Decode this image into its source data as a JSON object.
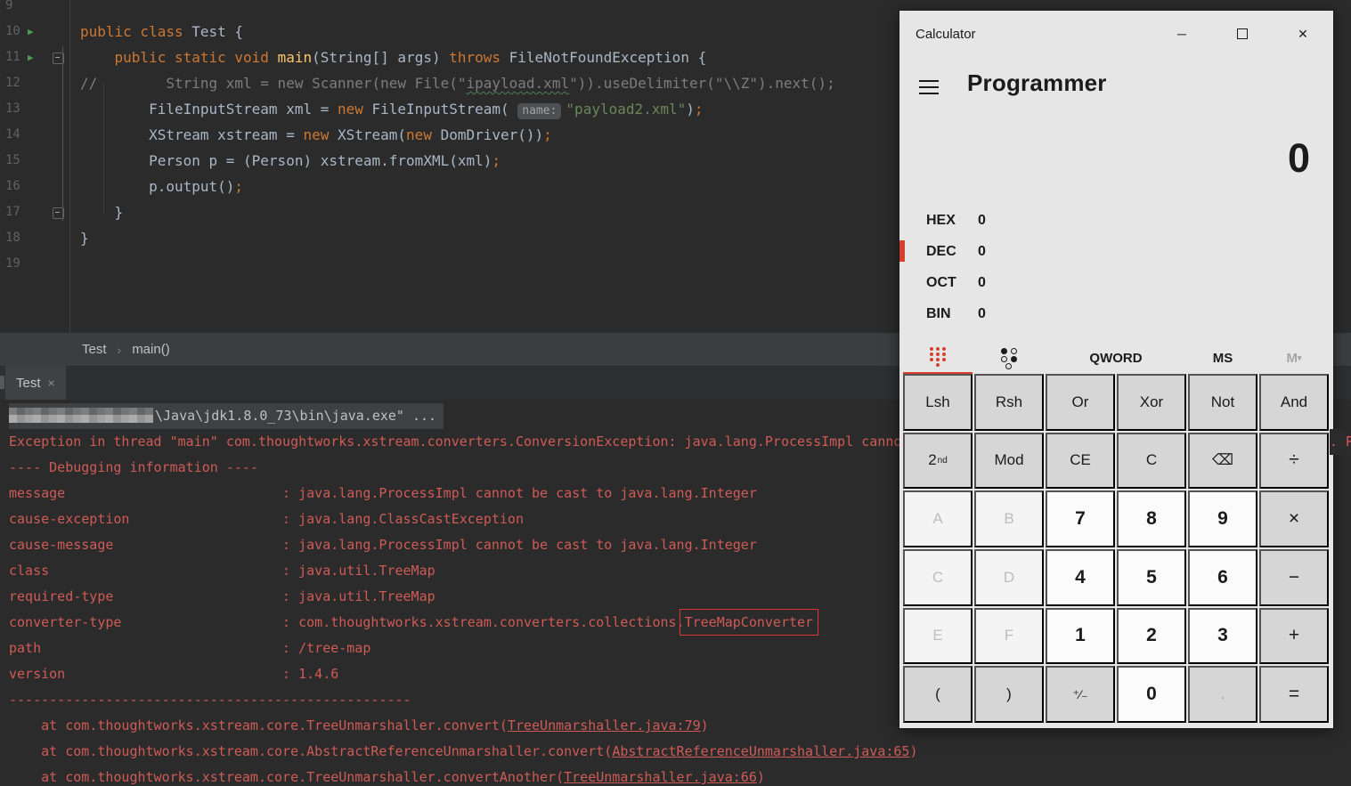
{
  "editor": {
    "lines": [
      {
        "num": "9",
        "seg": []
      },
      {
        "num": "10",
        "run": true,
        "seg": [
          [
            "kw",
            "public class "
          ],
          [
            "pl",
            "Test {"
          ]
        ]
      },
      {
        "num": "11",
        "run": true,
        "fold": true,
        "seg": [
          [
            "pl",
            "    "
          ],
          [
            "kw",
            "public static void "
          ],
          [
            "mth",
            "main"
          ],
          [
            "pl",
            "(String[] args) "
          ],
          [
            "kw",
            "throws "
          ],
          [
            "pl",
            "FileNotFoundException {"
          ]
        ]
      },
      {
        "num": "12",
        "seg": [
          [
            "cmt",
            "//        String xml = new Scanner(new File(\""
          ],
          [
            "sq",
            "ipayload.xml"
          ],
          [
            "cmt",
            "\")).useDelimiter(\"\\\\Z\").next();"
          ]
        ]
      },
      {
        "num": "13",
        "seg": [
          [
            "pl",
            "        FileInputStream xml = "
          ],
          [
            "kw",
            "new "
          ],
          [
            "pl",
            "FileInputStream( "
          ],
          [
            "hint",
            "name:"
          ],
          [
            "str",
            "\"payload2.xml\""
          ],
          [
            "pl",
            ")"
          ],
          [
            "kw",
            ";"
          ]
        ]
      },
      {
        "num": "14",
        "seg": [
          [
            "pl",
            "        XStream xstream = "
          ],
          [
            "kw",
            "new "
          ],
          [
            "pl",
            "XStream("
          ],
          [
            "kw",
            "new "
          ],
          [
            "pl",
            "DomDriver())"
          ],
          [
            "kw",
            ";"
          ]
        ]
      },
      {
        "num": "15",
        "seg": [
          [
            "pl",
            "        Person p = (Person) xstream.fromXML(xml)"
          ],
          [
            "kw",
            ";"
          ]
        ]
      },
      {
        "num": "16",
        "seg": [
          [
            "pl",
            "        p.output()"
          ],
          [
            "kw",
            ";"
          ]
        ]
      },
      {
        "num": "17",
        "fold": true,
        "seg": [
          [
            "pl",
            "    }"
          ]
        ]
      },
      {
        "num": "18",
        "seg": [
          [
            "pl",
            "}"
          ]
        ]
      },
      {
        "num": "19",
        "seg": []
      }
    ]
  },
  "breadcrumb": {
    "items": [
      "Test",
      "main()"
    ],
    "separator": "›"
  },
  "console_tab": {
    "label": "Test",
    "close_glyph": "×"
  },
  "console": {
    "cmd_line_text": "\\Java\\jdk1.8.0_73\\bin\\java.exe\" ...",
    "exception_line": "Exception in thread \"main\" com.thoughtworks.xstream.converters.ConversionException: java.lang.ProcessImpl cannot be cast to java.lang.Integer : java.lang.ProcessImpl cannot be cast to java.lang.Integer",
    "edge_fragment": ". Pr",
    "debug_header": "---- Debugging information ----",
    "entries": [
      {
        "key": "message",
        "segs": [
          [
            "v",
            "java.lang.ProcessImpl cannot be cast to java.lang.Integer"
          ]
        ]
      },
      {
        "key": "cause-exception",
        "segs": [
          [
            "v",
            "java.lang.ClassCastException"
          ]
        ]
      },
      {
        "key": "cause-message",
        "segs": [
          [
            "v",
            "java.lang.ProcessImpl cannot be cast to java.lang.Integer"
          ]
        ]
      },
      {
        "key": "class",
        "segs": [
          [
            "v",
            "java.util.TreeMap"
          ]
        ]
      },
      {
        "key": "required-type",
        "segs": [
          [
            "v",
            "java.util.TreeMap"
          ]
        ]
      },
      {
        "key": "converter-type",
        "segs": [
          [
            "v",
            "com.thoughtworks.xstream.converters.collections."
          ],
          [
            "box",
            "TreeMapConverter"
          ]
        ]
      },
      {
        "key": "path",
        "segs": [
          [
            "v",
            "/tree-map"
          ]
        ]
      },
      {
        "key": "version",
        "segs": [
          [
            "v",
            "1.4.6"
          ]
        ]
      }
    ],
    "divider": "--------------------------------------------------",
    "stack": [
      {
        "pre": "    at com.thoughtworks.xstream.core.TreeUnmarshaller.convert(",
        "link": "TreeUnmarshaller.java:79",
        "post": ")"
      },
      {
        "pre": "    at com.thoughtworks.xstream.core.AbstractReferenceUnmarshaller.convert(",
        "link": "AbstractReferenceUnmarshaller.java:65",
        "post": ")"
      },
      {
        "pre": "    at com.thoughtworks.xstream.core.TreeUnmarshaller.convertAnother(",
        "link": "TreeUnmarshaller.java:66",
        "post": ")"
      }
    ]
  },
  "calculator": {
    "title": "Calculator",
    "minimize_glyph": "─",
    "close_glyph": "✕",
    "mode": "Programmer",
    "display_value": "0",
    "radix_rows": [
      {
        "label": "HEX",
        "value": "0",
        "active": false
      },
      {
        "label": "DEC",
        "value": "0",
        "active": true
      },
      {
        "label": "OCT",
        "value": "0",
        "active": false
      },
      {
        "label": "BIN",
        "value": "0",
        "active": false
      }
    ],
    "toolbar": {
      "word_size": "QWORD",
      "memory_store": "MS",
      "memory_base": "M",
      "memory_sup": "▾"
    },
    "accent_red": "#d5402e",
    "key_rows": [
      [
        {
          "l": "Lsh",
          "n": "lsh",
          "t": "fn"
        },
        {
          "l": "Rsh",
          "n": "rsh",
          "t": "fn"
        },
        {
          "l": "Or",
          "n": "or",
          "t": "fn"
        },
        {
          "l": "Xor",
          "n": "xor",
          "t": "fn"
        },
        {
          "l": "Not",
          "n": "not",
          "t": "fn"
        },
        {
          "l": "And",
          "n": "and",
          "t": "fn"
        }
      ],
      [
        {
          "l": "2",
          "sup": "nd",
          "n": "second",
          "t": "fn"
        },
        {
          "l": "Mod",
          "n": "mod",
          "t": "fn"
        },
        {
          "l": "CE",
          "n": "clear-entry",
          "t": "fn"
        },
        {
          "l": "C",
          "n": "clear",
          "t": "fn"
        },
        {
          "l": "⌫",
          "n": "backspace",
          "t": "fn"
        },
        {
          "l": "÷",
          "n": "divide",
          "t": "op"
        }
      ],
      [
        {
          "l": "A",
          "n": "hex-a",
          "t": "hex"
        },
        {
          "l": "B",
          "n": "hex-b",
          "t": "hex"
        },
        {
          "l": "7",
          "n": "7",
          "t": "num"
        },
        {
          "l": "8",
          "n": "8",
          "t": "num"
        },
        {
          "l": "9",
          "n": "9",
          "t": "num"
        },
        {
          "l": "×",
          "n": "multiply",
          "t": "op"
        }
      ],
      [
        {
          "l": "C",
          "n": "hex-c",
          "t": "hex"
        },
        {
          "l": "D",
          "n": "hex-d",
          "t": "hex"
        },
        {
          "l": "4",
          "n": "4",
          "t": "num"
        },
        {
          "l": "5",
          "n": "5",
          "t": "num"
        },
        {
          "l": "6",
          "n": "6",
          "t": "num"
        },
        {
          "l": "−",
          "n": "minus",
          "t": "op"
        }
      ],
      [
        {
          "l": "E",
          "n": "hex-e",
          "t": "hex"
        },
        {
          "l": "F",
          "n": "hex-f",
          "t": "hex"
        },
        {
          "l": "1",
          "n": "1",
          "t": "num"
        },
        {
          "l": "2",
          "n": "2",
          "t": "num"
        },
        {
          "l": "3",
          "n": "3",
          "t": "num"
        },
        {
          "l": "+",
          "n": "plus",
          "t": "op"
        }
      ],
      [
        {
          "l": "(",
          "n": "open-paren",
          "t": "fn"
        },
        {
          "l": ")",
          "n": "close-paren",
          "t": "fn"
        },
        {
          "l": "⁺⁄₋",
          "n": "plus-minus",
          "t": "fn",
          "small": true
        },
        {
          "l": "0",
          "n": "0",
          "t": "num"
        },
        {
          "l": ".",
          "n": "decimal",
          "t": "fn",
          "dis": true
        },
        {
          "l": "=",
          "n": "equals",
          "t": "op"
        }
      ]
    ]
  }
}
